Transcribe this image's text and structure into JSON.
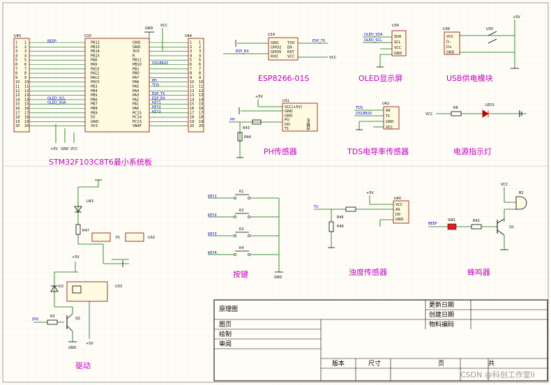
{
  "colors": {
    "title": "#c000c0",
    "wire": "#007000",
    "body": "#000000",
    "net": "#0000cc",
    "grid": "#e4e4e4",
    "paper": "#fffdf6",
    "led": "#c00000"
  },
  "stm32": {
    "title": "STM32F103C8T6最小系统板",
    "ref_u45": "U45",
    "ref_u15": "U15",
    "ref_u44": "U44",
    "left_pins": [
      "PB12",
      "PB13",
      "PB14",
      "PB15",
      "PA8",
      "PA9",
      "PA10",
      "PA11",
      "PA12",
      "PA15",
      "PB3",
      "PB4",
      "PB5",
      "PB6",
      "PB7",
      "PB8",
      "PB9",
      "5V",
      "GND",
      "3V3"
    ],
    "right_pins": [
      "GND",
      "GND",
      "3V3",
      "R",
      "PB11",
      "PB10",
      "PB1",
      "PB0",
      "PA7",
      "PA6",
      "PA5",
      "PA4",
      "PA3",
      "PA2",
      "PA1",
      "PA0",
      "PC15",
      "PC14",
      "PC13",
      "VBAT"
    ],
    "pin_numbers": [
      "1",
      "2",
      "3",
      "4",
      "5",
      "6",
      "7",
      "8",
      "9",
      "10",
      "11",
      "12",
      "13",
      "14",
      "15",
      "16",
      "17",
      "18",
      "19",
      "20"
    ],
    "left_nets": [
      "BEEP",
      "",
      "",
      "",
      "",
      "",
      "",
      "",
      "",
      "",
      "",
      "",
      "",
      "OLED_SCL",
      "OLED_SDA",
      "",
      "",
      "",
      "",
      ""
    ],
    "right_nets": [
      "",
      "",
      "",
      "",
      "",
      "DS18B20",
      "",
      "",
      "",
      "PH",
      "TDS",
      "",
      "ESP_TX",
      "ESP_RX",
      "KEY1",
      "KEY2",
      "KEY3",
      "",
      "",
      ""
    ],
    "power_labels": [
      "+5V",
      "GND",
      "VCC"
    ],
    "top_power": [
      "GND",
      "VCC"
    ]
  },
  "esp": {
    "title": "ESP8266-01S",
    "ref": "U14",
    "pins_left": [
      "GND",
      "GPIO2",
      "GPIO0",
      "RXD"
    ],
    "pins_right": [
      "TXD",
      "EN",
      "RST",
      "VCC"
    ],
    "nets": [
      "ESP_TX",
      "ESP_RX"
    ],
    "vcc": "VCC"
  },
  "oled": {
    "title": "OLED显示屏",
    "ref": "U34",
    "pins": [
      "SDA",
      "SCL",
      "VCC",
      "GND"
    ],
    "nets": [
      "OLED_SDA",
      "OLED_SCL"
    ]
  },
  "usb": {
    "title": "USB供电模块",
    "ref_conn": "U36",
    "ref_sw": "U35",
    "pins": [
      "VCC",
      "D-",
      "D+",
      "GND"
    ],
    "supply": "+5V"
  },
  "ph": {
    "title": "PH传感器",
    "ref": "U31",
    "pins": [
      "VCC(+5V)",
      "GND",
      "GND",
      "PO",
      "DO",
      "T1"
    ],
    "module": "PH模块",
    "supply": "+5V",
    "net": "PH",
    "res_ref": "R43",
    "res_ref2": "R44"
  },
  "tds": {
    "title": "TDS电导率传感器",
    "ref": "U42",
    "pins": [
      "A0",
      "T1",
      "GND",
      "VCC"
    ],
    "nets": [
      "TDS",
      "DS18B20"
    ]
  },
  "power_led": {
    "title": "电源指示灯",
    "res": "R8",
    "led": "LED1",
    "supply": "VCC"
  },
  "keys": {
    "title": "按键",
    "refs": [
      "K1",
      "K2",
      "K3",
      "K4"
    ],
    "nets": [
      "KEY1",
      "KEY2",
      "KEY3",
      "KEY4"
    ],
    "gnd": "GND"
  },
  "turbidity": {
    "title": "浊度传感器",
    "ref": "U40",
    "pins": [
      "VCC",
      "A0",
      "D0",
      "GND"
    ],
    "supply": "+5V",
    "net": "TU",
    "res": [
      "R45",
      "R46"
    ]
  },
  "buzzer": {
    "title": "蜂鸣器",
    "ref": "B2",
    "sw": "SW1",
    "res": "R42",
    "tr": "Q1",
    "net": "BEEP",
    "supply": "VCC"
  },
  "driver": {
    "title": "驱动",
    "led": "U43",
    "res": [
      "R47",
      "R3"
    ],
    "relay": "U33",
    "p": "P1",
    "diode": "D2",
    "tr": "Q2",
    "net": "JDQ",
    "supply": "+5V",
    "gnd": "GND",
    "u": "U32"
  },
  "title_block": {
    "drawing": "原理图",
    "page": "图页",
    "drawn": "绘制",
    "review": "审阅",
    "update_date": "更新日期",
    "create_date": "创建日期",
    "material_code": "物料编码",
    "version": "版本",
    "size": "尺寸",
    "pages": "页",
    "total": "共"
  },
  "watermark": "CSDN @科创工作室li"
}
